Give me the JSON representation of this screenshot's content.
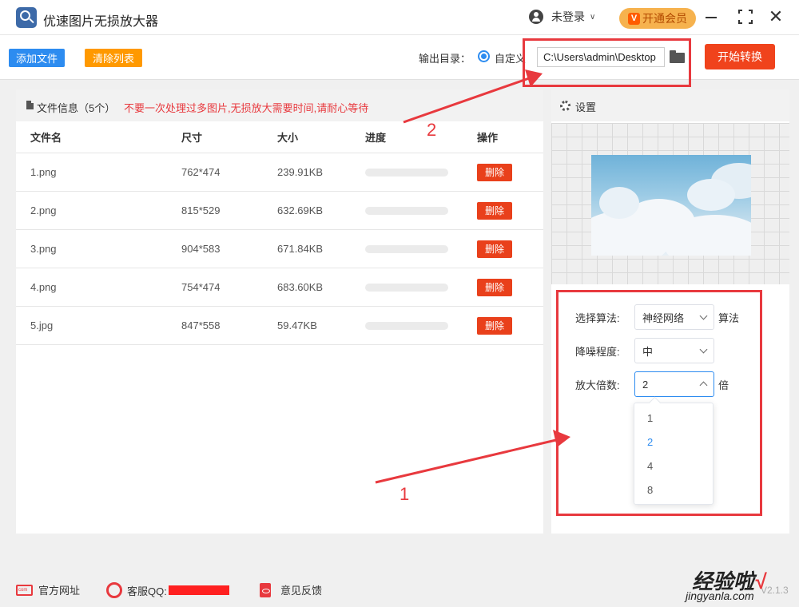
{
  "app": {
    "title": "优速图片无损放大器"
  },
  "header": {
    "user_label": "未登录",
    "vip_label": "开通会员",
    "vip_icon_text": "V"
  },
  "toolbar": {
    "add_label": "添加文件",
    "clear_label": "清除列表",
    "output_label": "输出目录：",
    "radio_label": "自定义",
    "path_value": "C:\\Users\\admin\\Desktop",
    "start_label": "开始转换"
  },
  "files": {
    "header_title": "文件信息（5个）",
    "warning": "不要一次处理过多图片,无损放大需要时间,请耐心等待",
    "columns": [
      "文件名",
      "尺寸",
      "大小",
      "进度",
      "操作"
    ],
    "delete_label": "删除",
    "rows": [
      {
        "name": "1.png",
        "size": "762*474",
        "filesize": "239.91KB",
        "progress": 0
      },
      {
        "name": "2.png",
        "size": "815*529",
        "filesize": "632.69KB",
        "progress": 0
      },
      {
        "name": "3.png",
        "size": "904*583",
        "filesize": "671.84KB",
        "progress": 0
      },
      {
        "name": "4.png",
        "size": "754*474",
        "filesize": "683.60KB",
        "progress": 0
      },
      {
        "name": "5.jpg",
        "size": "847*558",
        "filesize": "59.47KB",
        "progress": 0
      }
    ]
  },
  "settings": {
    "title": "设置",
    "algorithm_label": "选择算法:",
    "algorithm_value": "神经网络",
    "algorithm_unit": "算法",
    "noise_label": "降噪程度:",
    "noise_value": "中",
    "scale_label": "放大倍数:",
    "scale_value": "2",
    "scale_unit": "倍",
    "scale_options": [
      "1",
      "2",
      "4",
      "8"
    ]
  },
  "annotations": {
    "label_1": "1",
    "label_2": "2"
  },
  "footer": {
    "website_label": "官方网址",
    "support_label": "客服QQ:",
    "feedback_label": "意见反馈",
    "version": "V2.1.3"
  },
  "watermark": {
    "main": "经验啦",
    "check": "√",
    "sub": "jingyanla.com"
  },
  "colors": {
    "primary": "#2d8cf0",
    "warning_orange": "#ff9900",
    "start_red": "#f0431c",
    "annotation_red": "#e8393e"
  }
}
